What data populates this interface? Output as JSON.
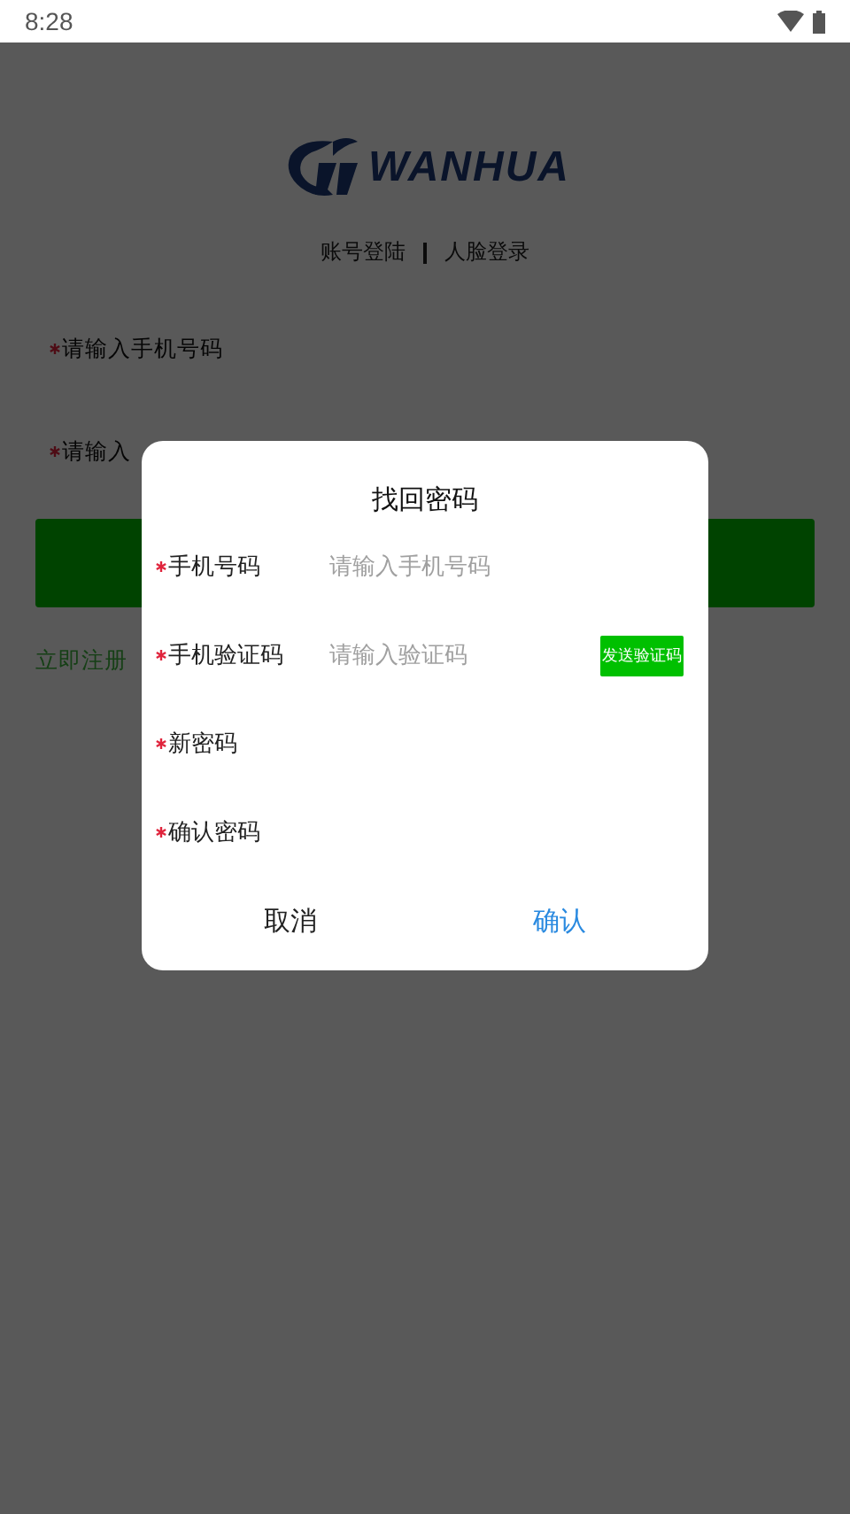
{
  "status_bar": {
    "time": "8:28"
  },
  "logo": {
    "text": "WANHUA"
  },
  "login_tabs": [
    {
      "label": "账号登陆"
    },
    {
      "label": "人脸登录"
    }
  ],
  "login_fields": [
    {
      "required": true,
      "placeholder": "请输入手机号码"
    },
    {
      "required": true,
      "placeholder": "请输入"
    }
  ],
  "register_link": "立即注册",
  "dialog": {
    "title": "找回密码",
    "fields": [
      {
        "label": "手机号码",
        "required": true,
        "placeholder": "请输入手机号码"
      },
      {
        "label": "手机验证码",
        "required": true,
        "placeholder": "请输入验证码",
        "button": "发送验证码"
      },
      {
        "label": "新密码",
        "required": true
      },
      {
        "label": "确认密码",
        "required": true
      }
    ],
    "cancel": "取消",
    "confirm": "确认"
  }
}
